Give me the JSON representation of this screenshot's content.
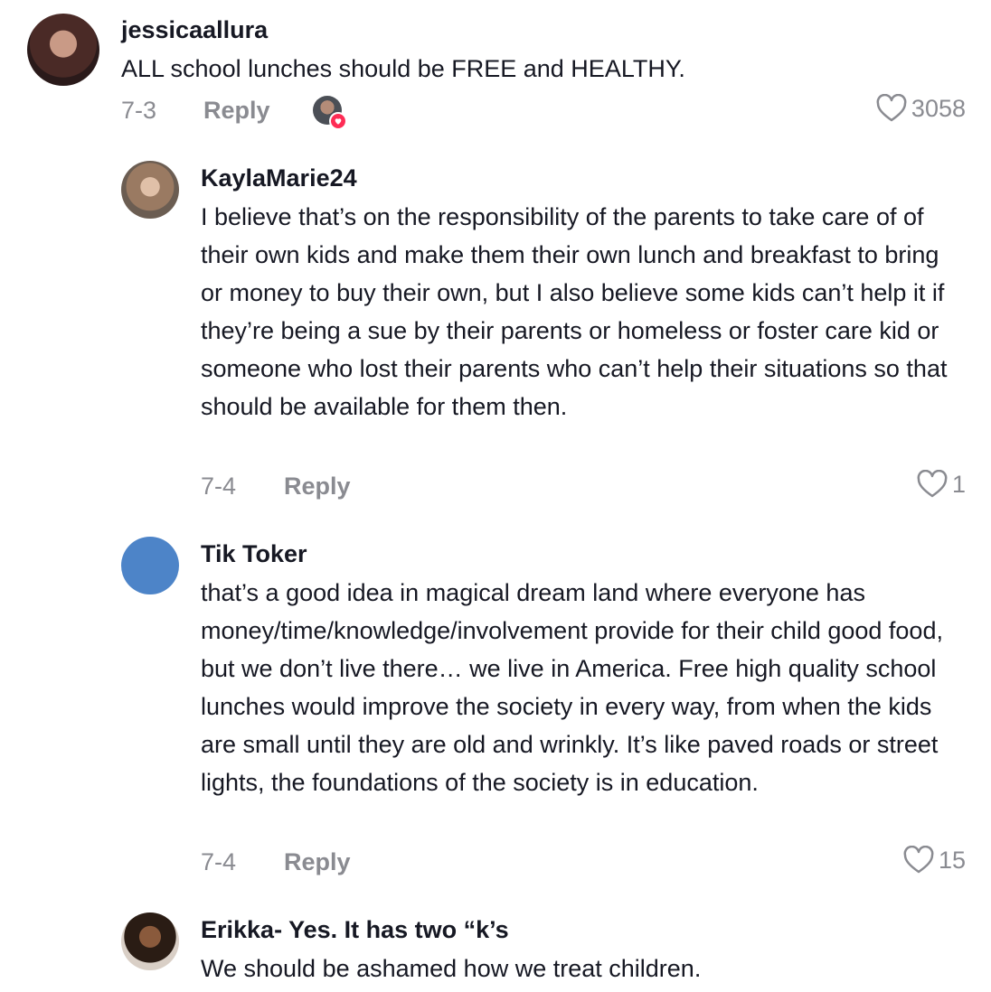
{
  "comments": [
    {
      "username": "jessicaallura",
      "text": "ALL school lunches should be FREE and HEALTHY.",
      "date": "7-3",
      "reply_label": "Reply",
      "likes": "3058",
      "creator_liked": true
    },
    {
      "username": "KaylaMarie24",
      "text": "I believe that’s on the responsibility of the parents to take care of of their own kids and make them their own lunch and breakfast to bring or money to buy their own, but I also believe some kids can’t help it if they’re being a sue by their parents or homeless or foster care kid or someone who lost their parents who can’t help their situations so that should be available for them then.",
      "date": "7-4",
      "reply_label": "Reply",
      "likes": "1"
    },
    {
      "username": "Tik Toker",
      "text": "that’s a good idea in magical dream land where everyone has money/time/knowledge/involvement provide for their child good food, but we don’t live there… we live in America. Free high quality school lunches would improve the society in every way, from when the kids are small until they are old and wrinkly. It’s like paved roads or street lights, the foundations of the society is in education.",
      "date": "7-4",
      "reply_label": "Reply",
      "likes": "15"
    },
    {
      "username": "Erikka- Yes. It has two “k’s",
      "text": "We should be ashamed how we treat children."
    }
  ],
  "icons": {
    "like": "heart-outline-icon",
    "creator_badge": "heart-filled-icon"
  },
  "colors": {
    "text_primary": "#161823",
    "text_secondary": "#8a8b91",
    "creator_badge": "#fe2c55",
    "default_avatar": "#4d84c8"
  }
}
